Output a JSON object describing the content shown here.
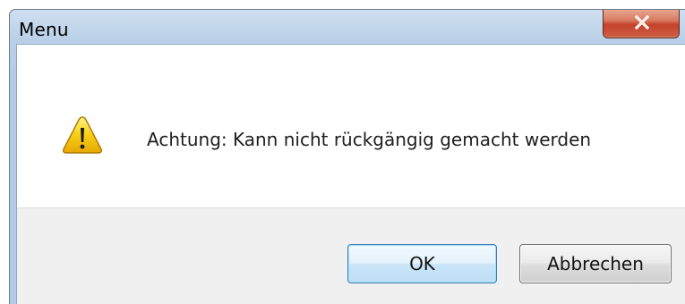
{
  "window": {
    "title": "Menu",
    "close_icon": "close-x-icon"
  },
  "dialog": {
    "icon": "warning-icon",
    "message": "Achtung: Kann nicht rückgängig gemacht werden"
  },
  "buttons": {
    "ok_label": "OK",
    "cancel_label": "Abbrechen"
  },
  "colors": {
    "titlebar": "#b9d0e8",
    "close_button": "#c4422a",
    "warning_fill": "#f5c400",
    "footer_bg": "#f0f0f0",
    "ok_border": "#3c7fb1"
  }
}
